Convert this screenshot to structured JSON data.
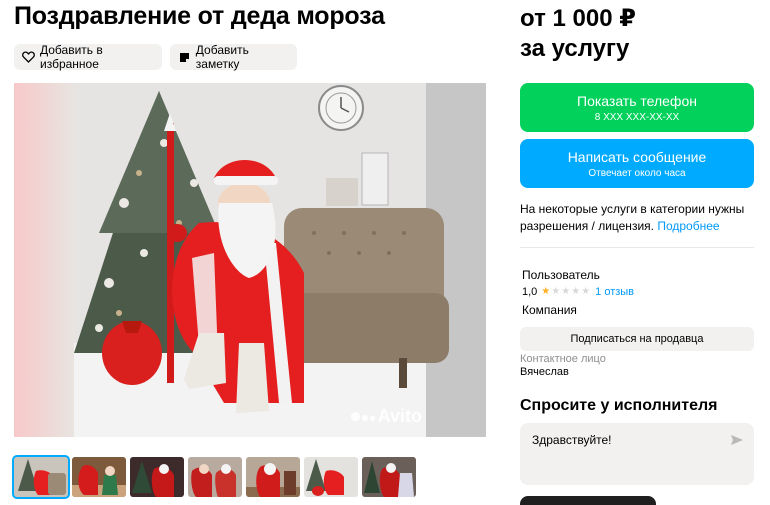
{
  "listing": {
    "title": "Поздравление от деда мороза",
    "favorite_label": "Добавить в избранное",
    "note_label": "Добавить заметку",
    "watermark": "Avito",
    "thumbnail_count": 7
  },
  "price": {
    "line1": "от 1 000 ₽",
    "line2": "за услугу"
  },
  "actions": {
    "phone_label": "Показать телефон",
    "phone_masked": "8 XXX XXX-XX-XX",
    "message_label": "Написать сообщение",
    "message_sub": "Отвечает около часа"
  },
  "license": {
    "text": "На некоторые услуги в категории нужны разрешения / лицензия.",
    "link": "Подробнее"
  },
  "seller": {
    "name": "Пользователь",
    "rating": "1,0",
    "rating_stars": 1,
    "reviews": "1 отзыв",
    "type": "Компания",
    "subscribe_label": "Подписаться на продавца",
    "contact_label": "Контактное лицо",
    "contact_name": "Вячеслав"
  },
  "ask": {
    "title": "Спросите у исполнителя",
    "message": "Здравствуйте!"
  },
  "colors": {
    "phone_button": "#02d15c",
    "message_button": "#00aaff",
    "link": "#0099f7",
    "star": "#ffb021",
    "chip": "#f2f1f0"
  }
}
